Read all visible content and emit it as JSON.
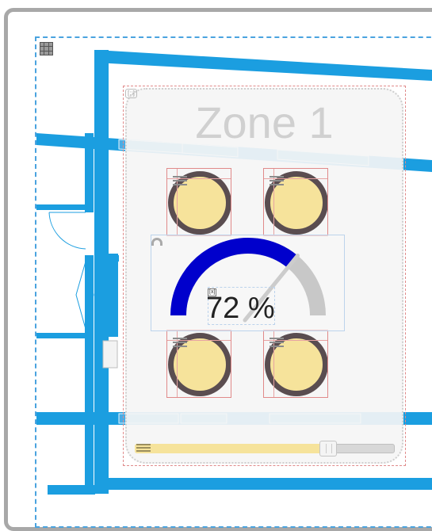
{
  "zone": {
    "title": "Zone 1",
    "tag": "[::]"
  },
  "lights": [
    {
      "name": "light-1",
      "on": true
    },
    {
      "name": "light-2",
      "on": true
    },
    {
      "name": "light-3",
      "on": true
    },
    {
      "name": "light-4",
      "on": true
    }
  ],
  "gauge": {
    "value": 72,
    "display": "72 %",
    "tag": "[x]"
  },
  "slider": {
    "value_percent": 72
  },
  "colors": {
    "wall": "#1b9ee0",
    "gauge_fill": "#0000cc",
    "gauge_track": "#c8c8c8",
    "bulb_fill": "#f6e39b",
    "bulb_ring": "#5a4d50",
    "frame": "#a8a8a8"
  },
  "icons": [
    "grid-icon",
    "menu-lines-icon",
    "gauge-icon",
    "slider-handle-icon"
  ]
}
